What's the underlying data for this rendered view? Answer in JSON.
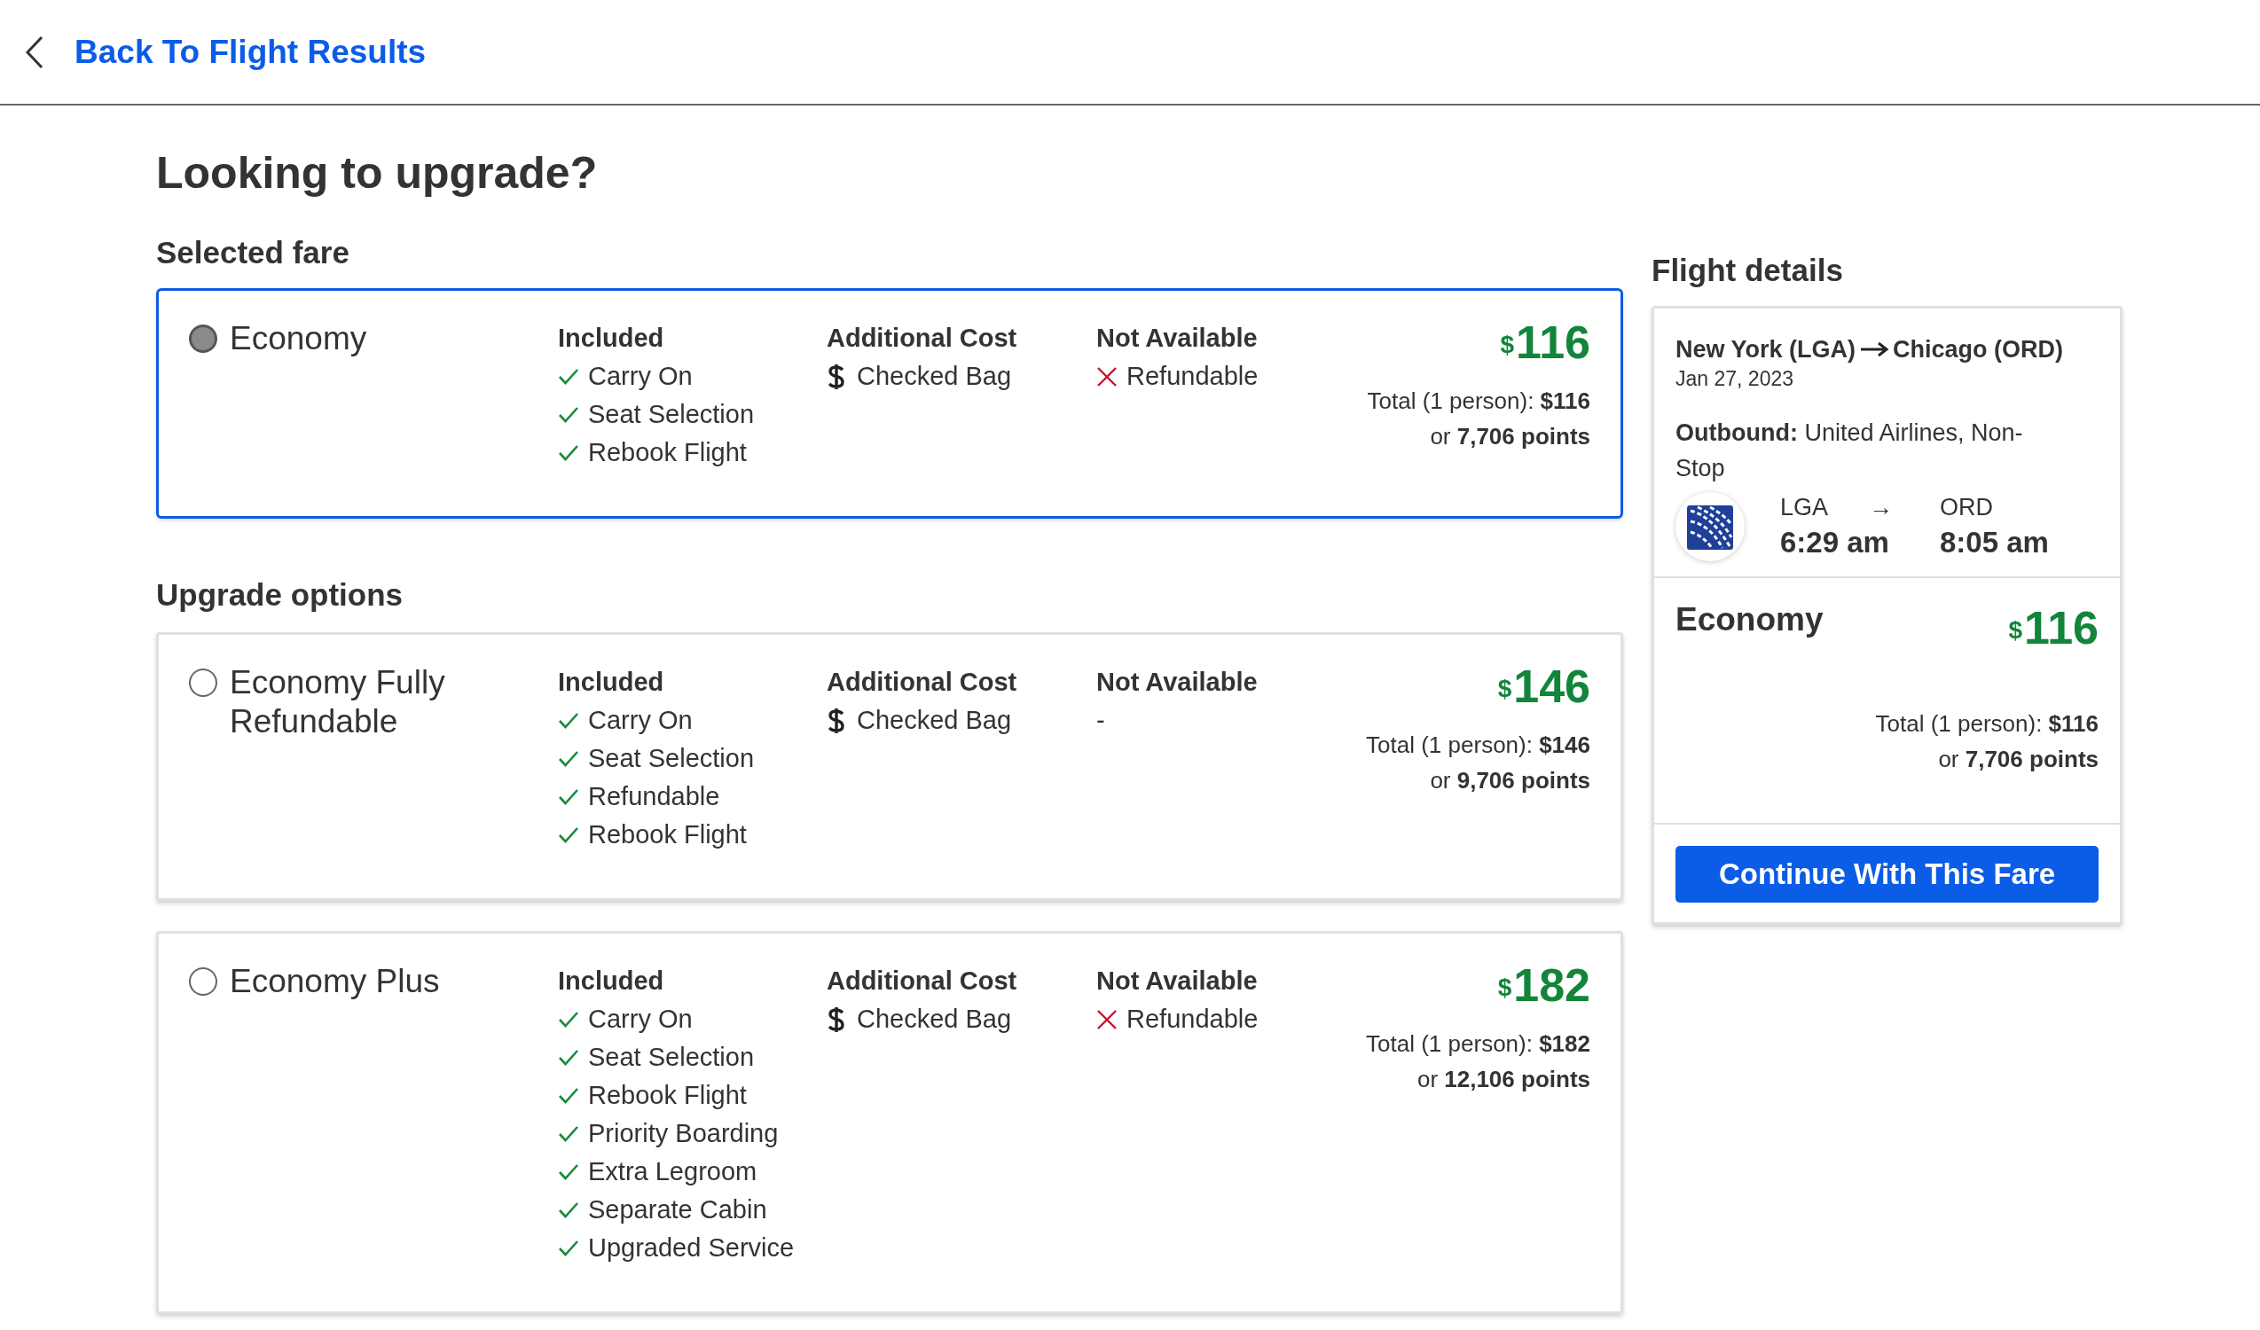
{
  "header": {
    "back_link": "Back To Flight Results"
  },
  "title": "Looking to upgrade?",
  "selected_section": {
    "heading": "Selected fare",
    "fares": [
      {
        "name": "Economy",
        "selected": true,
        "included_heading": "Included",
        "included": [
          "Carry On",
          "Seat Selection",
          "Rebook Flight"
        ],
        "additional_heading": "Additional Cost",
        "additional": [
          "Checked Bag"
        ],
        "unavailable_heading": "Not Available",
        "unavailable": [
          "Refundable"
        ],
        "currency": "$",
        "price": "116",
        "total": "Total (1 person): **$116**",
        "points": "or **7,706 points**"
      }
    ]
  },
  "upgrade_section": {
    "heading": "Upgrade options",
    "fares": [
      {
        "name": "Economy Fully Refundable",
        "selected": false,
        "included_heading": "Included",
        "included": [
          "Carry On",
          "Seat Selection",
          "Refundable",
          "Rebook Flight"
        ],
        "additional_heading": "Additional Cost",
        "additional": [
          "Checked Bag"
        ],
        "unavailable_heading": "Not Available",
        "unavailable_note": "-",
        "currency": "$",
        "price": "146",
        "total": "Total (1 person): **$146**",
        "points": "or **9,706 points**"
      },
      {
        "name": "Economy Plus",
        "selected": false,
        "included_heading": "Included",
        "included": [
          "Carry On",
          "Seat Selection",
          "Rebook Flight",
          "Priority Boarding",
          "Extra Legroom",
          "Separate Cabin",
          "Upgraded Service"
        ],
        "additional_heading": "Additional Cost",
        "additional": [
          "Checked Bag"
        ],
        "unavailable_heading": "Not Available",
        "unavailable": [
          "Refundable"
        ],
        "currency": "$",
        "price": "182",
        "total": "Total (1 person): **$182**",
        "points": "or **12,106 points**"
      }
    ]
  },
  "flight_details": {
    "heading": "Flight details",
    "route_from": "New York (LGA)",
    "route_to": "Chicago (ORD)",
    "date": "Jan 27, 2023",
    "outbound": "**Outbound:** United Airlines, Non-Stop",
    "departure": {
      "code": "LGA",
      "time": "6:29 am"
    },
    "arrow": "→",
    "arrival": {
      "code": "ORD",
      "time": "8:05 am"
    },
    "fare_name": "Economy",
    "currency": "$",
    "price": "116",
    "total": "Total (1 person): **$116**",
    "points": "or **7,706 points**",
    "button": "Continue With This Fare"
  }
}
